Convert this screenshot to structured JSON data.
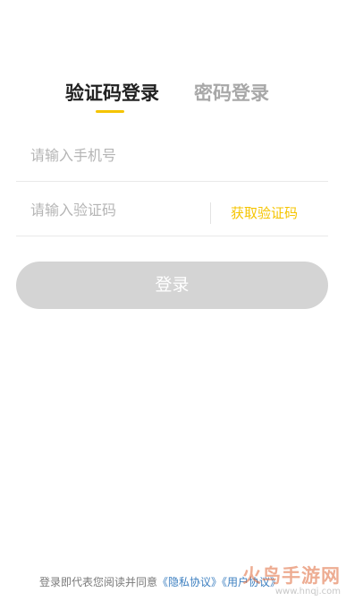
{
  "tabs": {
    "sms_login": "验证码登录",
    "password_login": "密码登录"
  },
  "form": {
    "phone_placeholder": "请输入手机号",
    "code_placeholder": "请输入验证码",
    "get_code": "获取验证码"
  },
  "login_button": "登录",
  "agreement": {
    "prefix": "登录即代表您阅读并同意",
    "privacy": "《隐私协议》",
    "user": "《用户协议》"
  },
  "watermark": {
    "text": "火鸟手游网",
    "url": "www.hnqj.com"
  },
  "colors": {
    "accent": "#f5c400",
    "button_disabled": "#d4d4d4",
    "link": "#3c7fc0"
  }
}
